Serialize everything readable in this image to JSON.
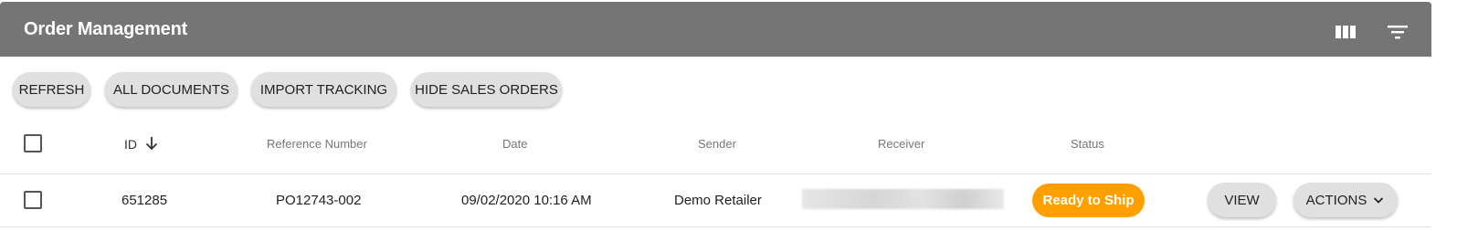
{
  "header": {
    "title": "Order Management",
    "icons": [
      "view-columns-icon",
      "filter-list-icon"
    ],
    "background": "#757575"
  },
  "toolbar": {
    "buttons": [
      {
        "label": "REFRESH"
      },
      {
        "label": "ALL DOCUMENTS"
      },
      {
        "label": "IMPORT TRACKING"
      },
      {
        "label": "HIDE SALES ORDERS"
      }
    ]
  },
  "table": {
    "columns": [
      "ID",
      "Reference Number",
      "Date",
      "Sender",
      "Receiver",
      "Status"
    ],
    "sort_icon": "arrow-down-icon",
    "rows": [
      {
        "id": "651285",
        "reference": "PO12743-002",
        "date": "09/02/2020 10:16 AM",
        "sender": "Demo Retailer",
        "receiver": "",
        "status": "Ready to Ship",
        "status_color": "#ffa000",
        "view_label": "VIEW",
        "actions_label": "ACTIONS"
      }
    ]
  }
}
